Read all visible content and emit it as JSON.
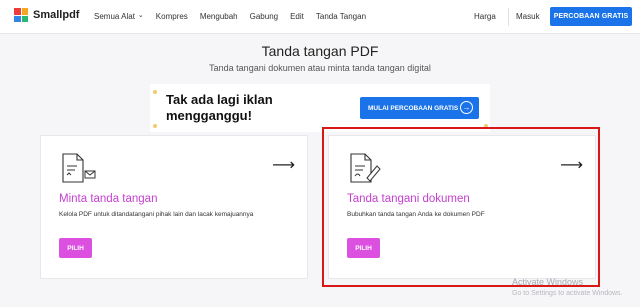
{
  "header": {
    "brand": "Smallpdf",
    "nav": [
      "Semua Alat",
      "Kompres",
      "Mengubah",
      "Gabung",
      "Edit",
      "Tanda Tangan"
    ],
    "pricing": "Harga",
    "login": "Masuk",
    "trial": "PERCOBAAN GRATIS"
  },
  "page": {
    "title": "Tanda tangan PDF",
    "subtitle": "Tanda tangani dokumen atau minta tanda tangan digital"
  },
  "ad": {
    "line1": "Tak ada lagi iklan",
    "line2": "mengganggu!",
    "button": "MULAI PERCOBAAN GRATIS"
  },
  "cards": [
    {
      "title": "Minta tanda tangan",
      "desc": "Kelola PDF untuk ditandatangani pihak lain dan lacak kemajuannya",
      "button": "PILIH"
    },
    {
      "title": "Tanda tangani dokumen",
      "desc": "Bubuhkan tanda tangan Anda ke dokumen PDF",
      "button": "PILIH"
    }
  ],
  "watermark": {
    "title": "Activate Windows",
    "subtitle": "Go to Settings to activate Windows."
  },
  "colors": {
    "accent": "#1a73e8",
    "card_title": "#c43fcf",
    "button_pink": "#db50de",
    "highlight": "#d81717"
  }
}
